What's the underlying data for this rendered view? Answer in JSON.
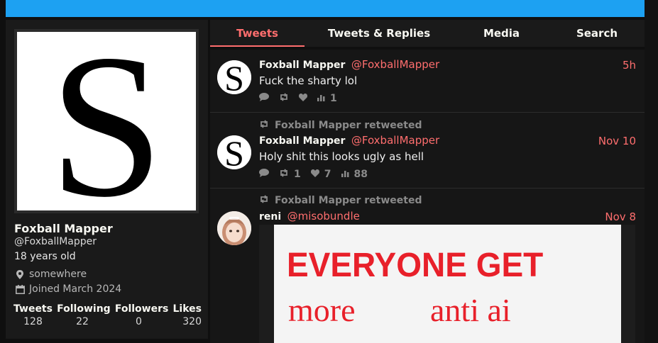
{
  "colors": {
    "accent": "#ff6e6e",
    "topbar": "#1da1f2",
    "muted": "#8a8a8a"
  },
  "profile": {
    "avatar_letter": "S",
    "name": "Foxball Mapper",
    "handle": "@FoxballMapper",
    "bio": "18 years old",
    "location": "somewhere",
    "joined": "Joined March 2024",
    "stats": [
      {
        "label": "Tweets",
        "value": "128"
      },
      {
        "label": "Following",
        "value": "22"
      },
      {
        "label": "Followers",
        "value": "0"
      },
      {
        "label": "Likes",
        "value": "320"
      }
    ]
  },
  "tabs": [
    {
      "label": "Tweets",
      "active": true
    },
    {
      "label": "Tweets & Replies",
      "active": false
    },
    {
      "label": "Media",
      "active": false
    },
    {
      "label": "Search",
      "active": false
    }
  ],
  "tweets": [
    {
      "retweet_label": "",
      "name": "Foxball Mapper",
      "handle": "@FoxballMapper",
      "date": "5h",
      "text": "Fuck the sharty lol",
      "replies": "",
      "retweets": "",
      "likes": "",
      "views": "1"
    },
    {
      "retweet_label": "Foxball Mapper retweeted",
      "name": "Foxball Mapper",
      "handle": "@FoxballMapper",
      "date": "Nov 10",
      "text": "Holy shit this looks ugly as hell",
      "replies": "",
      "retweets": "1",
      "likes": "7",
      "views": "88"
    },
    {
      "retweet_label": "Foxball Mapper retweeted",
      "name": "reni",
      "handle": "@misobundle",
      "date": "Nov 8",
      "media": {
        "line1": "EVERYONE GET",
        "line2a": "more",
        "line2b": "anti ai"
      }
    }
  ],
  "icons": [
    "map-pin-icon",
    "calendar-icon",
    "reply-icon",
    "retweet-icon",
    "like-icon",
    "views-icon"
  ]
}
